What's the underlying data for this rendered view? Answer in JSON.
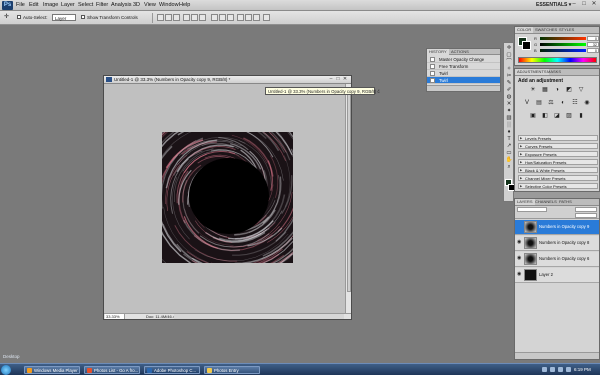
{
  "menubar": {
    "app_icon": "Ps",
    "items": [
      "File",
      "Edit",
      "Image",
      "Layer",
      "Select",
      "Filter",
      "Analysis",
      "3D",
      "View",
      "Window",
      "Help"
    ],
    "workspace": "ESSENTIALS ▾",
    "window_controls": {
      "minimize": "–",
      "maximize": "□",
      "close": "✕"
    }
  },
  "options": {
    "auto_select_label": "Auto-Select:",
    "auto_select_value": "Layer",
    "show_transform_label": "Show Transform Controls"
  },
  "document": {
    "title": "Untitled-1 @ 33.3% (Numbers in Opacity copy 9, RGB/8) *",
    "zoom": "33.33%",
    "doc_info": "Doc: 11.4M/46.4M",
    "buttons": {
      "minimize": "–",
      "maximize": "□",
      "close": "✕"
    }
  },
  "tooltip": "Untitled-1 @ 33.3% (Numbers in Opacity copy 9, RGB/8) ć",
  "history": {
    "tabs": [
      "HISTORY",
      "ACTIONS"
    ],
    "rows": [
      {
        "label": "Master Opacity Change",
        "selected": false
      },
      {
        "label": "Free Transform",
        "selected": false
      },
      {
        "label": "Twirl",
        "selected": false
      },
      {
        "label": "Twirl",
        "selected": true
      }
    ]
  },
  "color_panel": {
    "tabs": [
      "COLOR",
      "SWATCHES",
      "STYLES"
    ],
    "sliders": [
      {
        "label": "R",
        "value": "0",
        "gradient": "linear-gradient(90deg,#003300,#ff3300)"
      },
      {
        "label": "G",
        "value": "32",
        "gradient": "linear-gradient(90deg,#000000,#00ff00)"
      },
      {
        "label": "B",
        "value": "0",
        "gradient": "linear-gradient(90deg,#002000,#0020ff)"
      }
    ],
    "foreground": "#12321a",
    "background": "#000000"
  },
  "adjustments": {
    "tabs": [
      "ADJUSTMENTS",
      "MASKS"
    ],
    "title": "Add an adjustment",
    "icons_row1": [
      "☀",
      "▦",
      "◑",
      "◩",
      "▽"
    ],
    "icons_row2": [
      "V",
      "▤",
      "⚖",
      "◐",
      "☷",
      "◉"
    ],
    "icons_row3": [
      "▣",
      "◧",
      "◪",
      "▨",
      "▮"
    ],
    "presets": [
      "Levels Presets",
      "Curves Presets",
      "Exposure Presets",
      "Hue/Saturation Presets",
      "Black & White Presets",
      "Channel Mixer Presets",
      "Selective Color Presets"
    ]
  },
  "layers": {
    "tabs": [
      "LAYERS",
      "CHANNELS",
      "PATHS"
    ],
    "rows": [
      {
        "name": "Numbers in Opacity copy 9",
        "selected": true,
        "visible": false
      },
      {
        "name": "Numbers in Opacity copy 8",
        "selected": false,
        "visible": true
      },
      {
        "name": "Numbers in Opacity copy 6",
        "selected": false,
        "visible": true
      },
      {
        "name": "Layer 2",
        "selected": false,
        "visible": true
      }
    ]
  },
  "tools": [
    "✛",
    "▢",
    "⌒",
    "✧",
    "✂",
    "✎",
    "✐",
    "◍",
    "✕",
    "✦",
    "▧",
    "░",
    "♦",
    "T",
    "↗",
    "▭",
    "✋",
    "⌕"
  ],
  "taskbar": {
    "desktop_label": "Desktop",
    "items": [
      {
        "label": "Windows Media Player",
        "icon_color": "#f49a1c"
      },
      {
        "label": "Photos List - Go A fro...",
        "icon_color": "#e5502a"
      },
      {
        "label": "Adobe Photoshop C...",
        "icon_color": "#2a67b0"
      },
      {
        "label": "Photos Entry",
        "icon_color": "#f2c94c"
      }
    ],
    "clock": "6:19 PM"
  }
}
